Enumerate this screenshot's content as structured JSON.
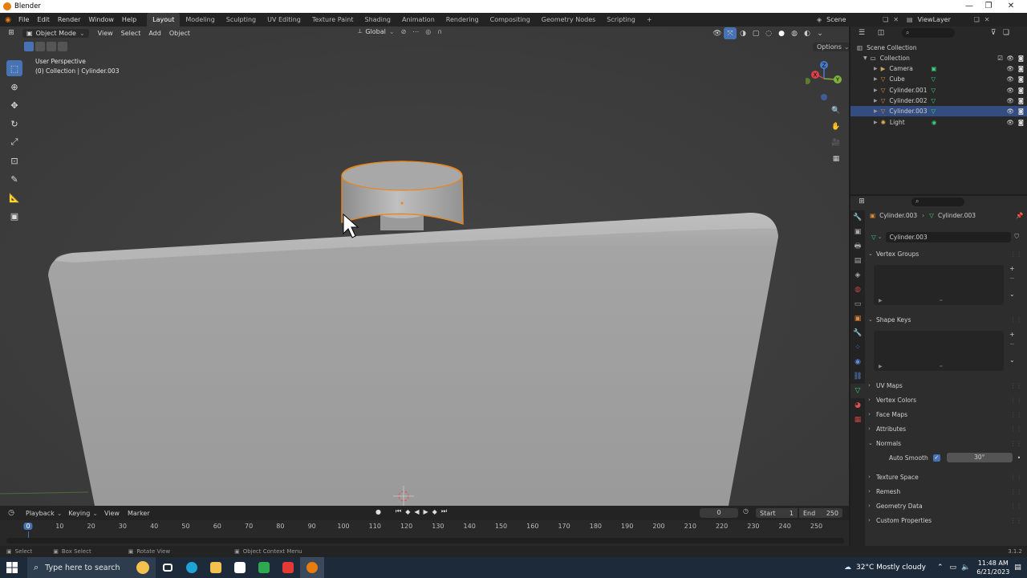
{
  "window": {
    "title": "Blender",
    "minimize": "—",
    "maximize": "❐",
    "close": "✕"
  },
  "menu": [
    "File",
    "Edit",
    "Render",
    "Window",
    "Help"
  ],
  "workspaces": [
    "Layout",
    "Modeling",
    "Sculpting",
    "UV Editing",
    "Texture Paint",
    "Shading",
    "Animation",
    "Rendering",
    "Compositing",
    "Geometry Nodes",
    "Scripting"
  ],
  "active_workspace": "Layout",
  "add_workspace": "+",
  "scene": {
    "name": "Scene",
    "view_layer": "ViewLayer"
  },
  "viewport": {
    "mode": "Object Mode",
    "menu": [
      "View",
      "Select",
      "Add",
      "Object"
    ],
    "transform_orientation": "Global",
    "options": "Options",
    "info_line1": "User Perspective",
    "info_line2": "(0) Collection | Cylinder.003"
  },
  "gizmo_axes": {
    "x": "X",
    "y": "Y",
    "z": "Z"
  },
  "outliner": {
    "root": "Scene Collection",
    "collection": "Collection",
    "items": [
      {
        "name": "Camera",
        "icon": "camera-icon",
        "color": "#c8a35a",
        "selected": false
      },
      {
        "name": "Cube",
        "icon": "mesh-icon",
        "color": "#e08a3c",
        "selected": false
      },
      {
        "name": "Cylinder.001",
        "icon": "mesh-icon",
        "color": "#e08a3c",
        "selected": false
      },
      {
        "name": "Cylinder.002",
        "icon": "mesh-icon",
        "color": "#e08a3c",
        "selected": false
      },
      {
        "name": "Cylinder.003",
        "icon": "mesh-icon",
        "color": "#e08a3c",
        "selected": true
      },
      {
        "name": "Light",
        "icon": "light-icon",
        "color": "#d9b25a",
        "selected": false
      }
    ]
  },
  "properties": {
    "breadcrumb_object": "Cylinder.003",
    "breadcrumb_data": "Cylinder.003",
    "mesh_name": "Cylinder.003",
    "panels": [
      {
        "label": "Vertex Groups",
        "open": true
      },
      {
        "label": "Shape Keys",
        "open": true
      },
      {
        "label": "UV Maps",
        "open": false
      },
      {
        "label": "Vertex Colors",
        "open": false
      },
      {
        "label": "Face Maps",
        "open": false
      },
      {
        "label": "Attributes",
        "open": false
      },
      {
        "label": "Normals",
        "open": true
      },
      {
        "label": "Texture Space",
        "open": false
      },
      {
        "label": "Remesh",
        "open": false
      },
      {
        "label": "Geometry Data",
        "open": false
      },
      {
        "label": "Custom Properties",
        "open": false
      }
    ],
    "auto_smooth_label": "Auto Smooth",
    "auto_smooth_checked": true,
    "auto_smooth_angle": "30°"
  },
  "timeline": {
    "menu": [
      "Playback",
      "Keying",
      "View",
      "Marker"
    ],
    "current_frame": "0",
    "start_label": "Start",
    "start": "1",
    "end_label": "End",
    "end": "250",
    "ruler": [
      "0",
      "10",
      "20",
      "30",
      "40",
      "50",
      "60",
      "70",
      "80",
      "90",
      "100",
      "110",
      "120",
      "130",
      "140",
      "150",
      "160",
      "170",
      "180",
      "190",
      "200",
      "210",
      "220",
      "230",
      "240",
      "250"
    ]
  },
  "statusbar": {
    "select": "Select",
    "box_select": "Box Select",
    "rotate_view": "Rotate View",
    "context_menu": "Object Context Menu",
    "version": "3.1.2"
  },
  "taskbar": {
    "search_placeholder": "Type here to search",
    "weather": "32°C  Mostly cloudy",
    "time": "11:48 AM",
    "date": "6/21/2023",
    "apps": [
      {
        "name": "task-view-icon",
        "color": "#ffffff"
      },
      {
        "name": "edge-icon",
        "color": "#1fa3d6"
      },
      {
        "name": "file-explorer-icon",
        "color": "#f2c14e"
      },
      {
        "name": "store-icon",
        "color": "#ffffff"
      },
      {
        "name": "camtasia-icon",
        "color": "#2fa84f"
      },
      {
        "name": "recorder-icon",
        "color": "#e53935"
      },
      {
        "name": "blender-icon",
        "color": "#e87d0d"
      }
    ]
  }
}
